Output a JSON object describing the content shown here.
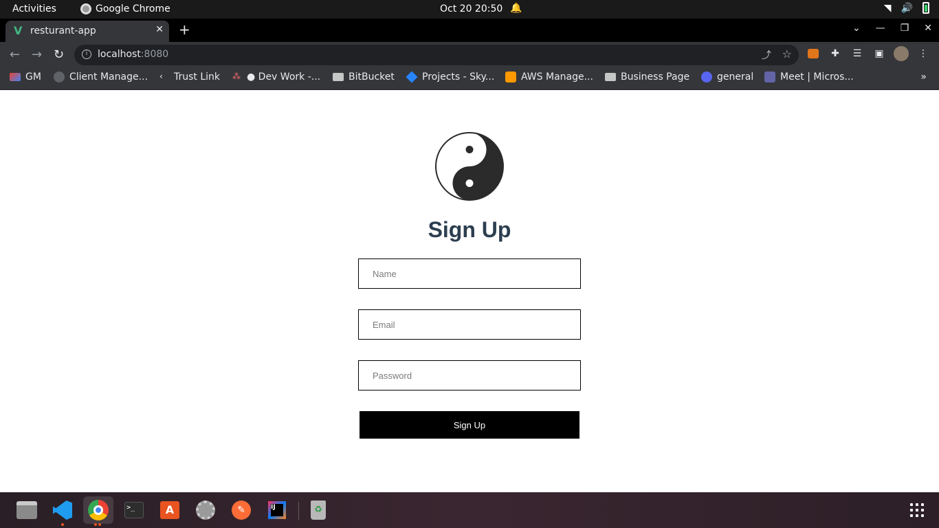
{
  "system_bar": {
    "activities": "Activities",
    "app_name": "Google Chrome",
    "clock": "Oct 20  20:50"
  },
  "browser": {
    "tab_title": "resturant-app",
    "url_host": "localhost",
    "url_port": ":8080"
  },
  "bookmarks": [
    {
      "label": "GM",
      "icon": "gmail-icon"
    },
    {
      "label": "Client Manage...",
      "icon": "globe-icon"
    },
    {
      "label": "Trust Link",
      "icon": "link-icon"
    },
    {
      "label": "● Dev Work -...",
      "icon": "asana-icon"
    },
    {
      "label": "BitBucket",
      "icon": "folder-icon"
    },
    {
      "label": "Projects - Sky...",
      "icon": "jira-icon"
    },
    {
      "label": "AWS Manage...",
      "icon": "aws-icon"
    },
    {
      "label": "Business Page",
      "icon": "folder-icon"
    },
    {
      "label": "general",
      "icon": "discord-icon"
    },
    {
      "label": "Meet | Micros...",
      "icon": "teams-icon"
    }
  ],
  "page": {
    "heading": "Sign Up",
    "name_placeholder": "Name",
    "email_placeholder": "Email",
    "password_placeholder": "Password",
    "submit_label": "Sign Up"
  },
  "colors": {
    "heading": "#2c3e50",
    "button_bg": "#000000",
    "vue_green": "#41b883"
  }
}
